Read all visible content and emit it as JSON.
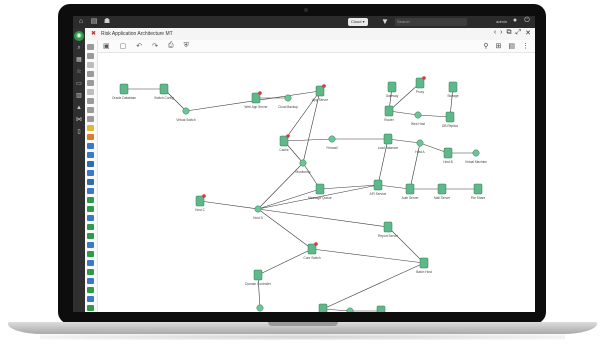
{
  "window": {
    "status_pill": "Cloud ▾",
    "search_placeholder": "Search",
    "user_label": "admin"
  },
  "document": {
    "title": "Risk Application Architecture MT",
    "close_icon": "close-icon"
  },
  "nodes": [
    {
      "label": "Oracle Database"
    },
    {
      "label": "Switch Config"
    },
    {
      "label": "Virtual Switch"
    },
    {
      "label": "Web App Server"
    },
    {
      "label": "Cloud Backup"
    },
    {
      "label": "App Server"
    },
    {
      "label": "Gateway"
    },
    {
      "label": "Proxy"
    },
    {
      "label": "Storage"
    },
    {
      "label": "Router"
    },
    {
      "label": "Web Host"
    },
    {
      "label": "DB Replica"
    },
    {
      "label": "Cache"
    },
    {
      "label": "Firewall"
    },
    {
      "label": "Load Balancer"
    },
    {
      "label": "Host A"
    },
    {
      "label": "Host B"
    },
    {
      "label": "Virtual Machine"
    },
    {
      "label": "Monitoring"
    },
    {
      "label": "Message Queue"
    },
    {
      "label": "API Service"
    },
    {
      "label": "Auth Server"
    },
    {
      "label": "Mail Server"
    },
    {
      "label": "File Share"
    },
    {
      "label": "Host C"
    },
    {
      "label": "Host D"
    },
    {
      "label": "Core Switch"
    },
    {
      "label": "Report Server"
    },
    {
      "label": "Batch Host"
    },
    {
      "label": "Domain Controller"
    },
    {
      "label": "Virtual Router"
    },
    {
      "label": "Backup Server"
    },
    {
      "label": "Edge Router"
    },
    {
      "label": "Data Store"
    }
  ]
}
